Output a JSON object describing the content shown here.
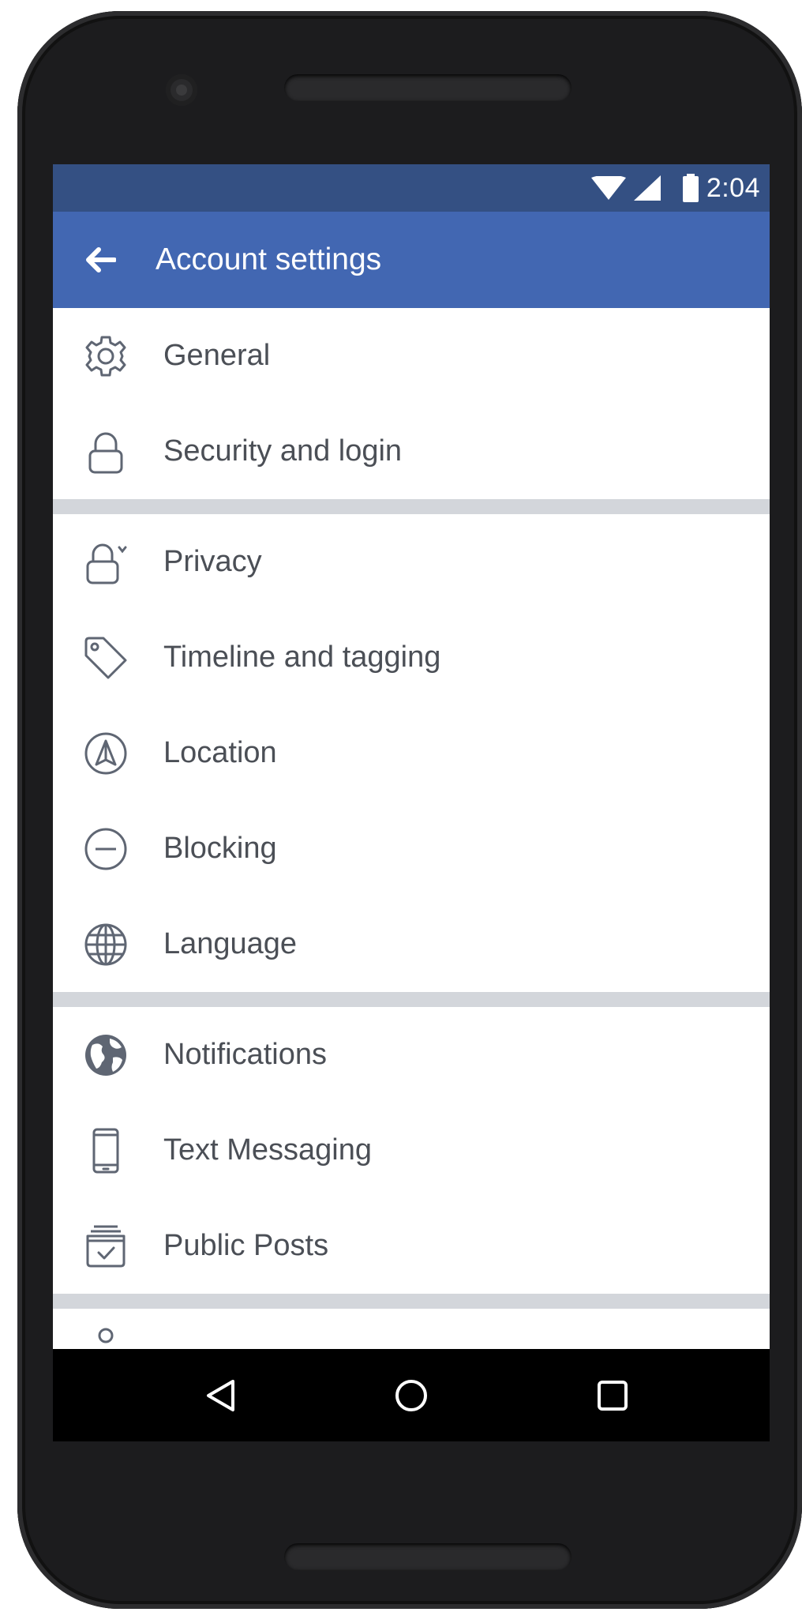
{
  "status_bar": {
    "time": "2:04",
    "icons": [
      "wifi-icon",
      "signal-icon",
      "battery-icon"
    ]
  },
  "app_bar": {
    "title": "Account settings",
    "back_icon": "arrow-left-icon"
  },
  "colors": {
    "status_bar": "#345083",
    "app_bar": "#4267b2",
    "label_text": "#4b4f56",
    "icon_stroke": "#5f6673",
    "divider": "#d3d6db",
    "nav_bar": "#000000"
  },
  "settings": {
    "groups": [
      {
        "items": [
          {
            "label": "General",
            "icon": "gear-icon"
          },
          {
            "label": "Security and login",
            "icon": "lock-icon"
          }
        ]
      },
      {
        "items": [
          {
            "label": "Privacy",
            "icon": "privacy-lock-icon"
          },
          {
            "label": "Timeline and tagging",
            "icon": "tag-icon"
          },
          {
            "label": "Location",
            "icon": "location-arrow-icon"
          },
          {
            "label": "Blocking",
            "icon": "block-icon"
          },
          {
            "label": "Language",
            "icon": "globe-grid-icon"
          }
        ]
      },
      {
        "items": [
          {
            "label": "Notifications",
            "icon": "globe-icon"
          },
          {
            "label": "Text Messaging",
            "icon": "phone-icon"
          },
          {
            "label": "Public Posts",
            "icon": "public-posts-icon"
          }
        ]
      }
    ]
  },
  "nav_bar": {
    "buttons": [
      "back-triangle-icon",
      "home-circle-icon",
      "recents-square-icon"
    ]
  }
}
